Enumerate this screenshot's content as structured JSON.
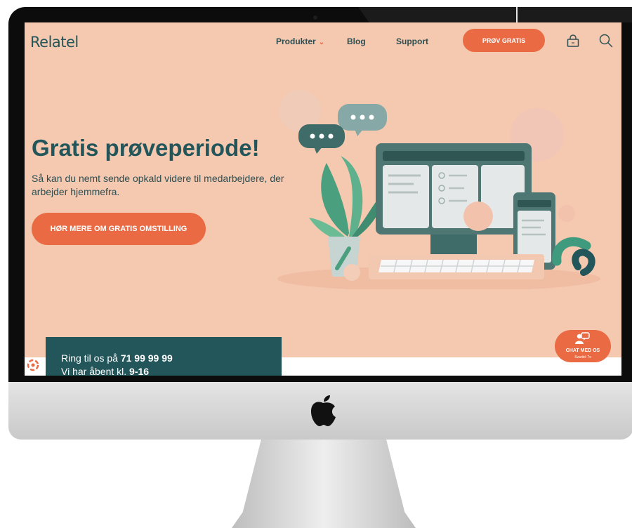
{
  "header": {
    "logo": "Relatel",
    "nav": [
      {
        "label": "Produkter"
      },
      {
        "label": "Blog"
      },
      {
        "label": "Support"
      }
    ],
    "cta_label": "PRØV GRATIS"
  },
  "hero": {
    "title": "Gratis prøveperiode!",
    "subtitle": "Så kan du nemt sende opkald videre til medarbejdere, der arbejder hjemmefra.",
    "button_label": "HØR MERE OM GRATIS OMSTILLING"
  },
  "contact": {
    "line1_prefix": "Ring til os på ",
    "phone": "71 99 99 99",
    "line2_prefix": "Vi har åbent kl. ",
    "hours": "9-16"
  },
  "chat": {
    "label": "CHAT MED OS",
    "status": "Svartid: 7s"
  },
  "colors": {
    "background": "#f5c8b0",
    "accent": "#ea6a43",
    "dark_teal": "#23565a"
  },
  "icons": [
    "chevron-down-icon",
    "cart-icon",
    "search-icon",
    "cookie-icon",
    "chat-icon",
    "apple-logo-icon"
  ]
}
